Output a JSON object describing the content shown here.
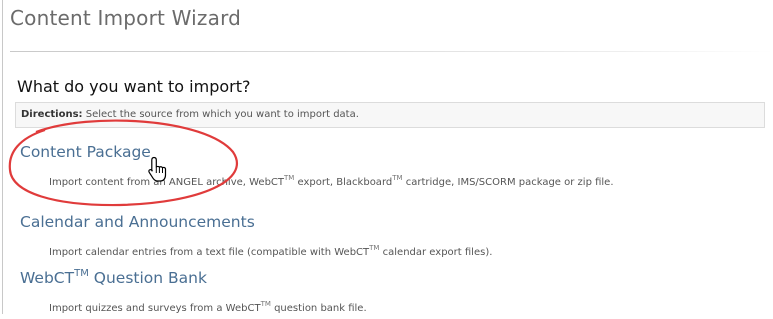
{
  "wizard": {
    "title": "Content Import Wizard"
  },
  "section": {
    "heading": "What do you want to import?"
  },
  "directions": {
    "label": "Directions:",
    "text": "Select the source from which you want to import data."
  },
  "options": [
    {
      "title": "Content Package",
      "description": {
        "p1": "Import content from an ANGEL archive, WebCT",
        "tm1": "TM",
        "p2": " export, Blackboard",
        "tm2": "TM",
        "p3": " cartridge, IMS/SCORM package or zip file."
      }
    },
    {
      "title": "Calendar and Announcements",
      "description": {
        "p1": "Import calendar entries from a text file (compatible with WebCT",
        "tm1": "TM",
        "p2": " calendar export files)."
      }
    },
    {
      "title_p1": "WebCT",
      "title_tm": "TM",
      "title_p2": " Question Bank",
      "description": {
        "p1": "Import quizzes and surveys from a WebCT",
        "tm1": "TM",
        "p2": " question bank file."
      }
    }
  ],
  "annotation": {
    "highlight_color": "#e03b3b",
    "cursor_icon": "hand-pointer-icon"
  }
}
